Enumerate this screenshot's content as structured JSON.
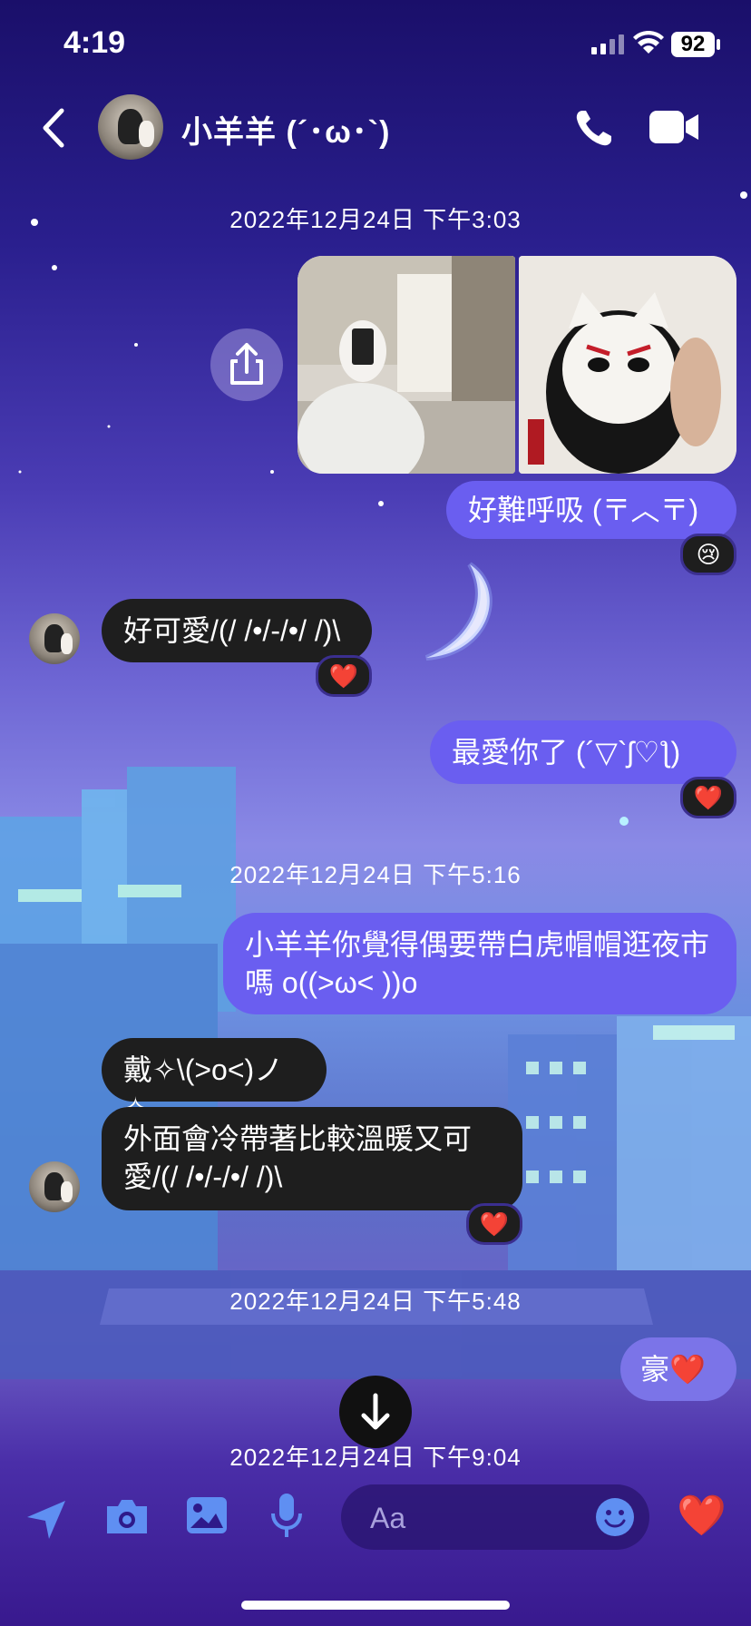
{
  "status_bar": {
    "time": "4:19",
    "battery": "92"
  },
  "header": {
    "contact_name": "小羊羊 (´･ω･`)",
    "icons": {
      "back": "chevron-left-icon",
      "call": "phone-icon",
      "video": "video-camera-icon"
    }
  },
  "messages": {
    "ts1": "2022年12月24日 下午3:03",
    "sent_1": "好難呼吸 (〒︿〒)",
    "sent_1_reaction": "😢",
    "recv_1": "好可愛/(/ /•/-/•/ /)\\",
    "recv_1_reaction": "❤️",
    "sent_2": "最愛你了 (´▽`ʃ♡ƪ)",
    "sent_2_reaction": "❤️",
    "ts2": "2022年12月24日 下午5:16",
    "sent_3": "小羊羊你覺得偶要帶白虎帽帽逛夜市嗎 o((>ω< ))o",
    "recv_2": "戴✧\\(>o<)ノ✧",
    "recv_3": "外面會冷帶著比較溫暖又可愛/(/ /•/-/•/ /)\\",
    "recv_3_reaction": "❤️",
    "ts3": "2022年12月24日 下午5:48",
    "sent_4": "豪❤️",
    "ts4": "2022年12月24日 下午9:04"
  },
  "composer": {
    "placeholder": "Aa",
    "like_emoji": "❤️",
    "icons": [
      "location-arrow-icon",
      "camera-icon",
      "image-icon",
      "microphone-icon",
      "emoji-icon"
    ]
  },
  "colors": {
    "sent_bubble": "#6a5ef0",
    "received_bubble": "#1e1e1e",
    "accent": "#6a5ef0"
  }
}
